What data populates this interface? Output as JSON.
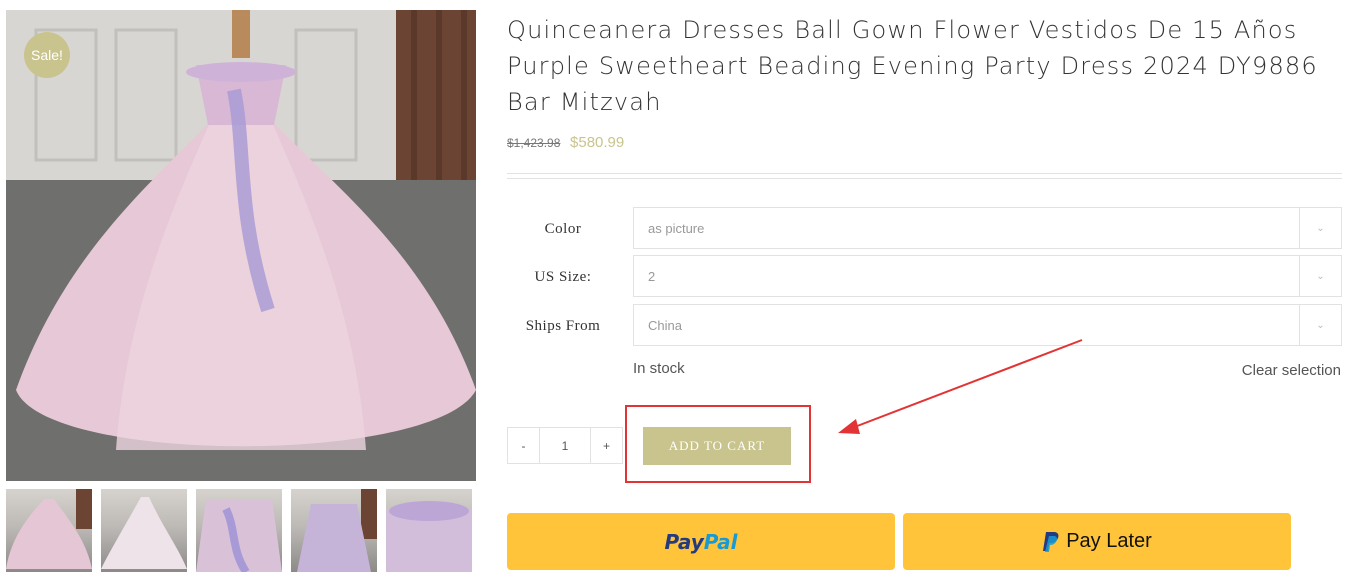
{
  "product": {
    "title": "Quinceanera Dresses Ball Gown Flower Vestidos De 15 Años Purple Sweetheart Beading Evening Party Dress 2024 DY9886 Bar Mitzvah",
    "price_old": "$1,423.98",
    "price_new": "$580.99",
    "sale_badge": "Sale!"
  },
  "variations": [
    {
      "label": "Color",
      "value": "as picture"
    },
    {
      "label": "US Size:",
      "value": "2"
    },
    {
      "label": "Ships From",
      "value": "China"
    }
  ],
  "stock_status": "In stock",
  "clear_selection": "Clear selection",
  "quantity": {
    "minus": "-",
    "value": "1",
    "plus": "+"
  },
  "add_to_cart": "ADD TO CART",
  "payment": {
    "paypal_pay": "Pay",
    "paypal_pal": "Pal",
    "pay_later": "Pay Later"
  },
  "colors": {
    "accent": "#c9c48d",
    "annotation": "#e23434",
    "paypal_yellow": "#ffc43a"
  }
}
